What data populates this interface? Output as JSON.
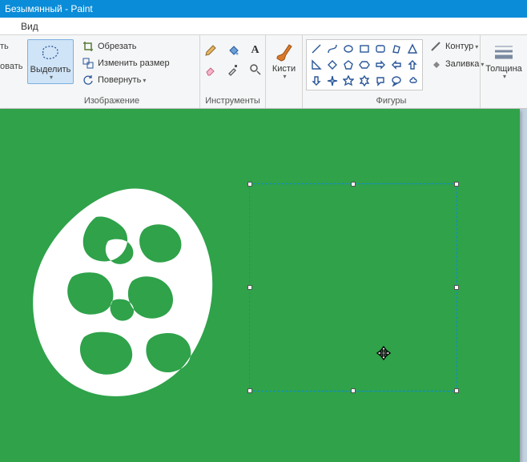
{
  "title": "Безымянный - Paint",
  "menu": {
    "view": "Вид"
  },
  "left_clip": {
    "l1": "ть",
    "l2": "овать"
  },
  "image_group": {
    "label": "Изображение",
    "select": "Выделить",
    "crop": "Обрезать",
    "resize": "Изменить размер",
    "rotate": "Повернуть"
  },
  "tools_group": {
    "label": "Инструменты"
  },
  "brushes_group": {
    "label": "Кисти"
  },
  "shapes_group": {
    "label": "Фигуры",
    "outline": "Контур",
    "fill": "Заливка"
  },
  "thickness_group": {
    "label": "Толщина"
  },
  "canvas": {
    "bg": "#2fa24a"
  }
}
